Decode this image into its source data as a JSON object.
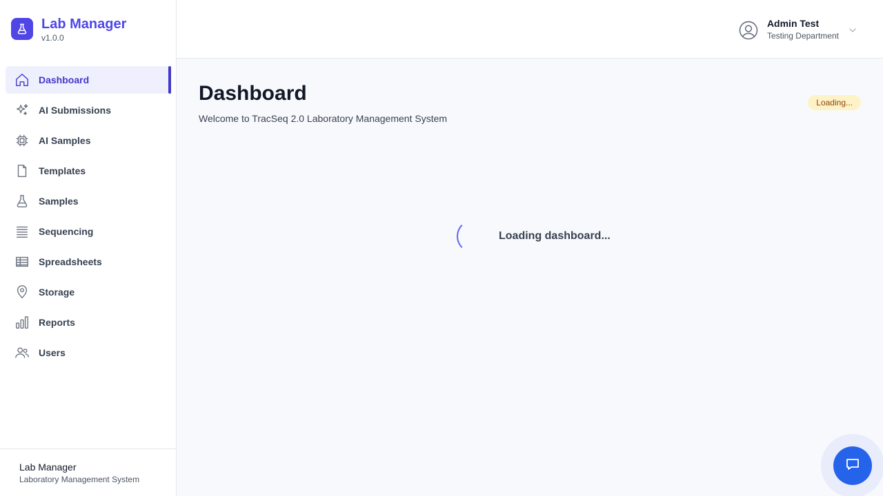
{
  "brand": {
    "title": "Lab Manager",
    "version": "v1.0.0",
    "color": "#4f46e5",
    "icon": "flask-icon"
  },
  "sidebar": {
    "items": [
      {
        "label": "Dashboard",
        "icon": "home-icon",
        "active": true
      },
      {
        "label": "AI Submissions",
        "icon": "sparkles-icon",
        "active": false
      },
      {
        "label": "AI Samples",
        "icon": "chip-icon",
        "active": false
      },
      {
        "label": "Templates",
        "icon": "document-icon",
        "active": false
      },
      {
        "label": "Samples",
        "icon": "beaker-icon",
        "active": false
      },
      {
        "label": "Sequencing",
        "icon": "stack-icon",
        "active": false
      },
      {
        "label": "Spreadsheets",
        "icon": "table-icon",
        "active": false
      },
      {
        "label": "Storage",
        "icon": "map-pin-icon",
        "active": false
      },
      {
        "label": "Reports",
        "icon": "bar-chart-icon",
        "active": false
      },
      {
        "label": "Users",
        "icon": "users-icon",
        "active": false
      }
    ],
    "footer": {
      "title": "Lab Manager",
      "subtitle": "Laboratory Management System"
    }
  },
  "header": {
    "user": {
      "name": "Admin Test",
      "department": "Testing Department",
      "icon": "user-circle-icon"
    }
  },
  "main": {
    "title": "Dashboard",
    "subtitle": "Welcome to TracSeq 2.0 Laboratory Management System",
    "status_badge": "Loading...",
    "loading_text": "Loading dashboard..."
  },
  "chat": {
    "icon": "chat-bubble-icon",
    "color": "#2563eb"
  }
}
